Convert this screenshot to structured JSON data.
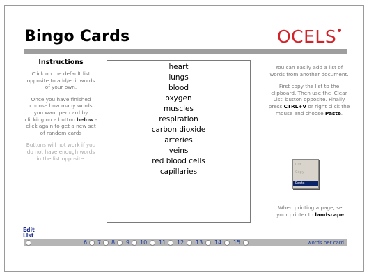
{
  "page": {
    "title": "Bingo Cards",
    "logo": "OCELS"
  },
  "instructions": {
    "heading": "Instructions",
    "p1": "Click on the default list opposite to add/edit words of your own.",
    "p2_a": "Once you have finished choose how many words you want per card by clicking on a button ",
    "p2_bold": "below",
    "p2_b": " - click again to get a new set of random cards",
    "p3": "Buttons will not work if you do not have enough words in the list opposite."
  },
  "words": [
    "heart",
    "lungs",
    "blood",
    "oxygen",
    "muscles",
    "respiration",
    "carbon dioxide",
    "arteries",
    "veins",
    "red blood cells",
    "capillaries"
  ],
  "right_notes": {
    "p1": "You can easily add a list of words from another document.",
    "p2_a": "First copy the list to the clipboard. Then use the 'Clear List' button opposite. Finally press ",
    "p2_key": "CTRL+V",
    "p2_b": " or right click the mouse and choose ",
    "p2_paste": "Paste",
    "p2_end": "."
  },
  "context_menu": {
    "items": [
      "Cut",
      "Copy",
      "Paste"
    ],
    "selected": "Paste"
  },
  "print_note": {
    "text": "When printing a page, set your printer to ",
    "bold": "landscape",
    "end": "!"
  },
  "edit_list": {
    "line1": "Edit",
    "line2": "List"
  },
  "word_counts": {
    "options": [
      "6",
      "7",
      "8",
      "9",
      "10",
      "11",
      "12",
      "13",
      "14",
      "15"
    ],
    "suffix": "words per card"
  }
}
